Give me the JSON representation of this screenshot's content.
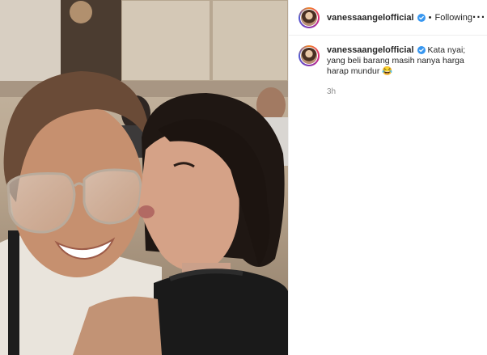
{
  "post": {
    "username": "vanessaangelofficial",
    "verified": true,
    "separator": "•",
    "follow_status": "Following",
    "more_icon": "more-horizontal-icon",
    "caption": {
      "text": "Kata nyai; yang beli barang masih nanya harga harap mundur",
      "emoji": "😂"
    },
    "timestamp": "3h"
  },
  "colors": {
    "verified_blue": "#3897f0",
    "timestamp_gray": "#8e8e8e",
    "text": "#262626"
  }
}
